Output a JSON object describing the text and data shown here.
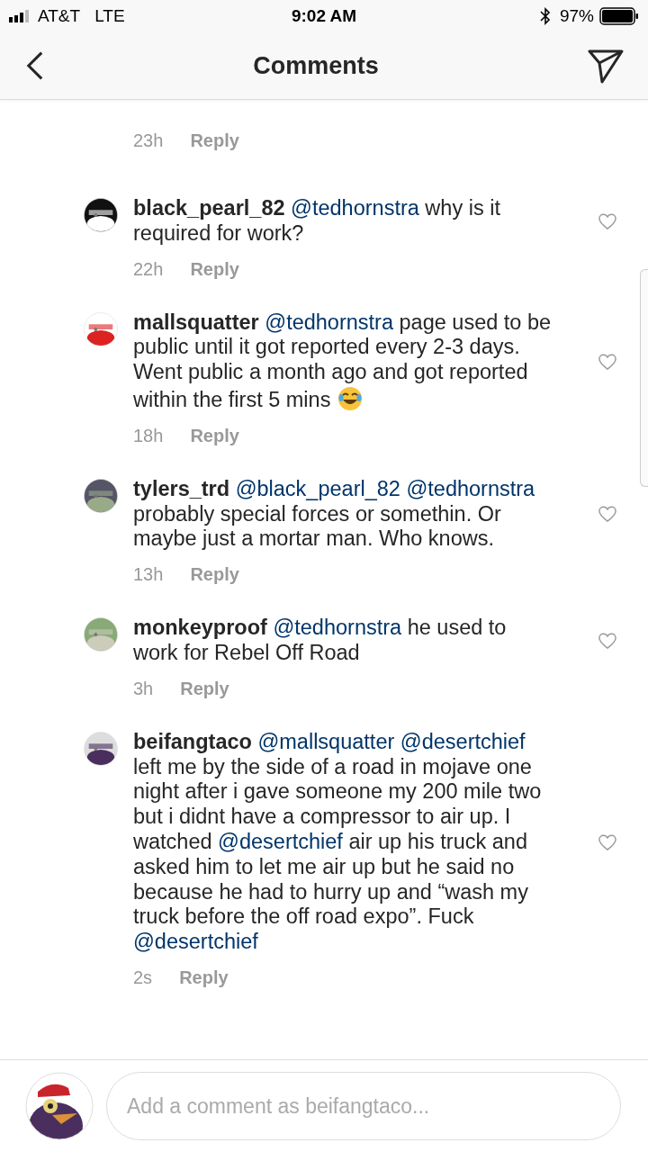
{
  "status_bar": {
    "carrier": "AT&T",
    "network": "LTE",
    "time": "9:02 AM",
    "battery": "97%"
  },
  "nav": {
    "title": "Comments"
  },
  "comments": [
    {
      "kind": "partial",
      "time": "23h",
      "reply": "Reply"
    },
    {
      "kind": "full",
      "username": "black_pearl_82",
      "body": [
        {
          "kind": "mention",
          "text": "@tedhornstra"
        },
        {
          "kind": "text",
          "text": " why is it required for work?"
        }
      ],
      "time": "22h",
      "reply": "Reply"
    },
    {
      "kind": "full",
      "username": "mallsquatter",
      "body": [
        {
          "kind": "mention",
          "text": "@tedhornstra"
        },
        {
          "kind": "text",
          "text": " page used to be public until it got reported every 2-3 days. Went public a month ago and got reported within the first 5 mins "
        },
        {
          "kind": "emoji"
        }
      ],
      "time": "18h",
      "reply": "Reply"
    },
    {
      "kind": "full",
      "username": "tylers_trd",
      "body": [
        {
          "kind": "mention",
          "text": "@black_pearl_82"
        },
        {
          "kind": "mention",
          "text": "@tedhornstra"
        },
        {
          "kind": "text",
          "text": " probably special forces or somethin. Or maybe just a mortar man. Who knows."
        }
      ],
      "time": "13h",
      "reply": "Reply"
    },
    {
      "kind": "full",
      "username": "monkeyproof",
      "body": [
        {
          "kind": "mention",
          "text": "@tedhornstra"
        },
        {
          "kind": "text",
          "text": " he used to work for Rebel Off Road"
        }
      ],
      "time": "3h",
      "reply": "Reply"
    },
    {
      "kind": "full",
      "username": "beifangtaco",
      "body": [
        {
          "kind": "mention",
          "text": "@mallsquatter"
        },
        {
          "kind": "mention",
          "text": "@desertchief"
        },
        {
          "kind": "text",
          "text": " left me by the side of a road in mojave one night after i gave someone my 200 mile two but i didnt have a compressor to air up. I watched  "
        },
        {
          "kind": "mention",
          "text": "@desertchief"
        },
        {
          "kind": "text",
          "text": " air up his truck and asked him to let me air up but he said no because he had to hurry up and “wash my truck before the off road expo”. Fuck "
        },
        {
          "kind": "mention",
          "text": "@desertchief"
        }
      ],
      "time": "2s",
      "reply": "Reply"
    }
  ],
  "composer": {
    "placeholder": "Add a comment as beifangtaco..."
  }
}
